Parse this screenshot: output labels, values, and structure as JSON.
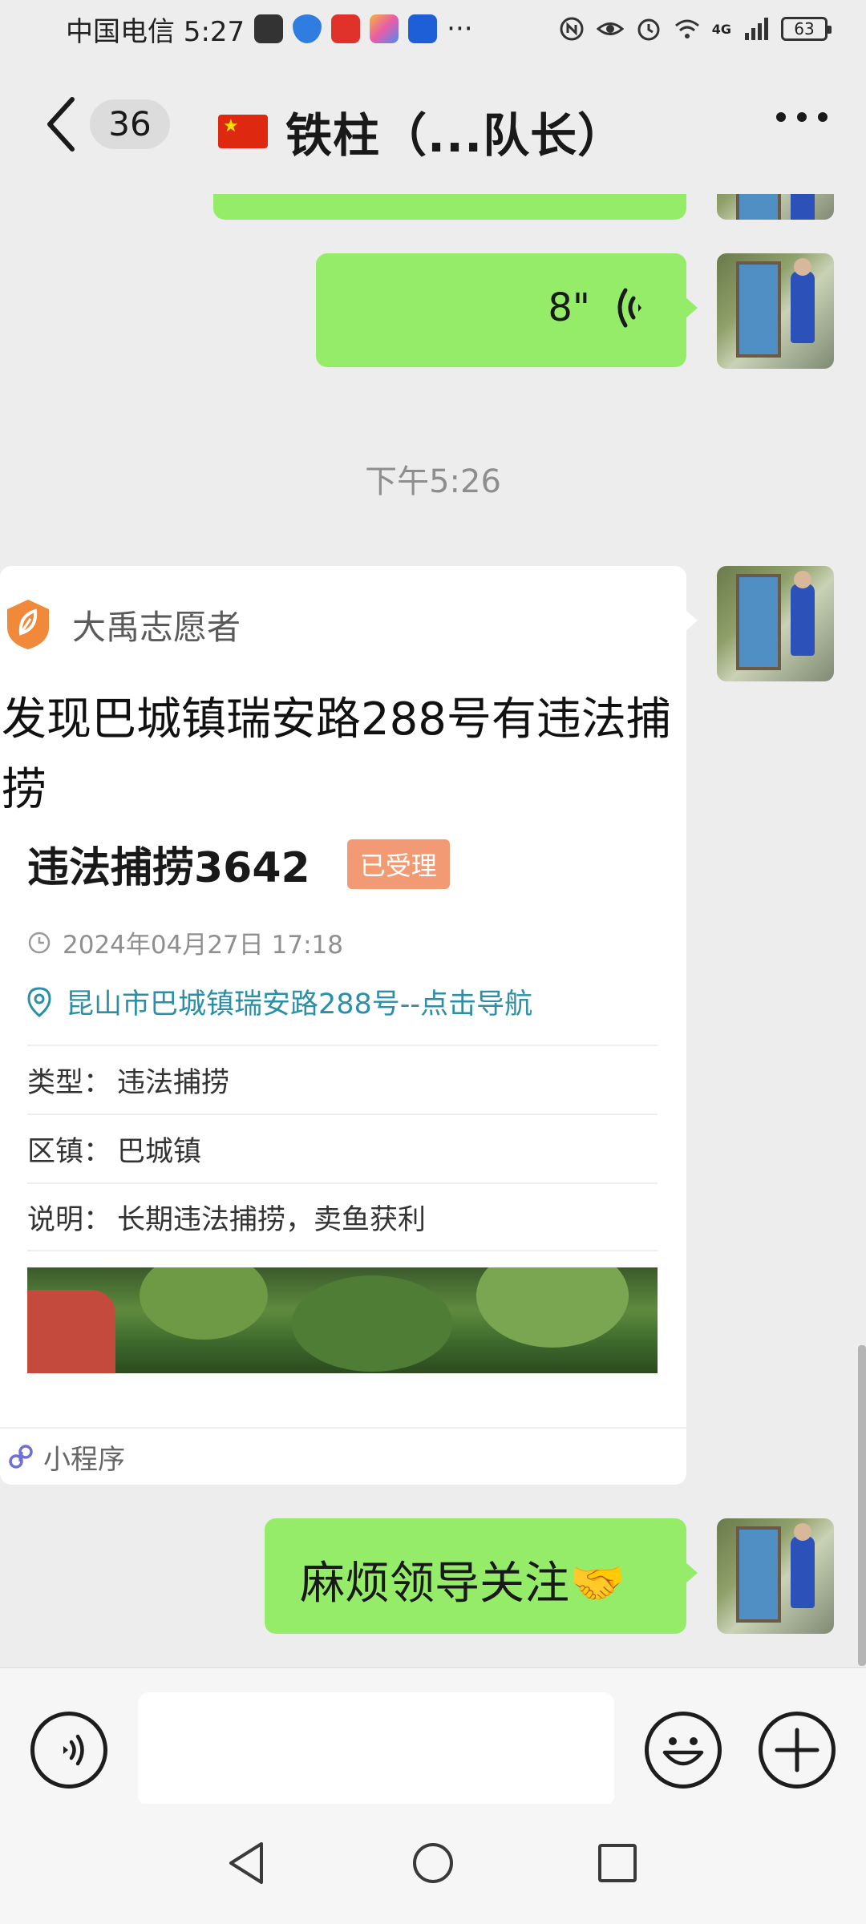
{
  "status_bar": {
    "carrier_time": "中国电信 5:27",
    "dots": "···",
    "network": "4G",
    "battery": "63"
  },
  "header": {
    "unread_count": "36",
    "chat_title": "铁柱（...队长）"
  },
  "messages": {
    "voice": {
      "duration": "8\""
    },
    "time_divider": "下午5:26",
    "card": {
      "source": "大禹志愿者",
      "title": "发现巴城镇瑞安路288号有违法捕捞",
      "case_name": "违法捕捞3642",
      "status": "已受理",
      "datetime": "2024年04月27日 17:18",
      "address": "昆山市巴城镇瑞安路288号--点击导航",
      "details": [
        {
          "key": "类型：",
          "value": "违法捕捞"
        },
        {
          "key": "区镇：",
          "value": "巴城镇"
        },
        {
          "key": "说明：",
          "value": "长期违法捕捞，卖鱼获利"
        }
      ],
      "footer_label": "小程序"
    },
    "last_text": "麻烦领导关注",
    "last_text_emoji": "🤝"
  },
  "icons": {
    "back": "chevron-left-icon",
    "more": "more-dots-icon",
    "voice_wave": "voice-wave-icon",
    "voice_input": "voice-input-icon",
    "emoji": "emoji-icon",
    "add": "add-icon",
    "clock": "clock-icon",
    "location": "location-pin-icon",
    "mini_program": "mini-program-icon"
  },
  "colors": {
    "bubble_green": "#95ec69",
    "background": "#ededed",
    "status_tag": "#f29a74",
    "address_link": "#2b8fa7"
  }
}
